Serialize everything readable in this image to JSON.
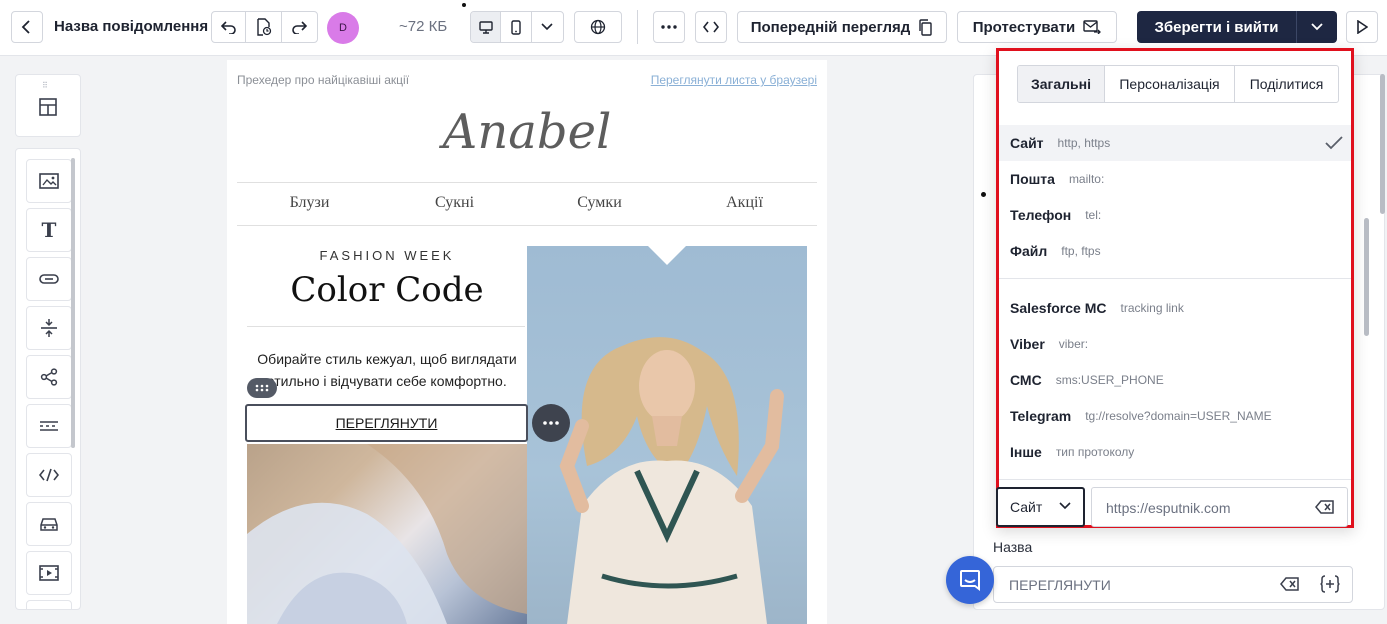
{
  "header": {
    "message_name": "Назва повідомлення",
    "avatar_initial": "D",
    "size": "~72 КБ",
    "preview_label": "Попередній перегляд",
    "test_label": "Протестувати",
    "save_label": "Зберегти і вийти"
  },
  "email": {
    "preheader": "Прехедер про найцікавіші акції",
    "view_in_browser": "Переглянути листа у браузері",
    "logo": "Anabel",
    "nav": [
      "Блузи",
      "Сукні",
      "Сумки",
      "Акції"
    ],
    "kicker": "FASHION WEEK",
    "headline": "Color Code",
    "body_line1": "Обирайте стиль кежуал, щоб виглядати",
    "body_line2": "стильно і відчувати себе комфортно.",
    "button_label": "ПЕРЕГЛЯНУТИ"
  },
  "link_dropdown": {
    "tabs": [
      {
        "label": "Загальні",
        "active": true
      },
      {
        "label": "Персоналізація",
        "active": false
      },
      {
        "label": "Поділитися",
        "active": false
      }
    ],
    "options_group1": [
      {
        "name": "Сайт",
        "hint": "http, https",
        "selected": true
      },
      {
        "name": "Пошта",
        "hint": "mailto:",
        "selected": false
      },
      {
        "name": "Телефон",
        "hint": "tel:",
        "selected": false
      },
      {
        "name": "Файл",
        "hint": "ftp, ftps",
        "selected": false
      }
    ],
    "options_group2": [
      {
        "name": "Salesforce MC",
        "hint": "tracking link"
      },
      {
        "name": "Viber",
        "hint": "viber:"
      },
      {
        "name": "СМС",
        "hint": "sms:USER_PHONE"
      },
      {
        "name": "Telegram",
        "hint": "tg://resolve?domain=USER_NAME"
      },
      {
        "name": "Інше",
        "hint": "тип протоколу"
      }
    ],
    "protocol_value": "Сайт",
    "url_value": "https://esputnik.com",
    "highlight_color": "#e0101d"
  },
  "right_panel": {
    "name_label": "Назва",
    "name_value": "ПЕРЕГЛЯНУТИ"
  },
  "colors": {
    "save_bg": "#1e2742",
    "avatar_bg": "#d97be8",
    "chat_bg": "#3565d8"
  }
}
